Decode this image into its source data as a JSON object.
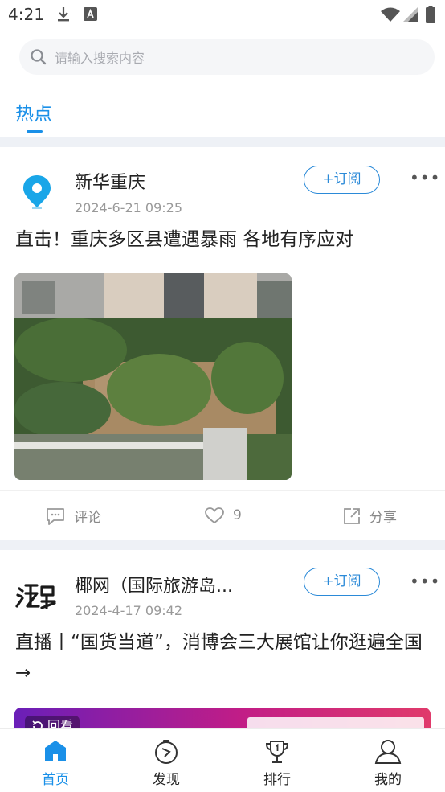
{
  "status_bar": {
    "time": "4:21"
  },
  "search": {
    "placeholder": "请输入搜索内容"
  },
  "tabs": [
    {
      "label": "热点",
      "active": true
    }
  ],
  "feed": [
    {
      "source": "新华重庆",
      "time": "2024-6-21 09:25",
      "subscribe_label": "+订阅",
      "headline": "直击！重庆多区县遭遇暴雨 各地有序应对",
      "actions": {
        "comment_label": "评论",
        "like_count": "9",
        "share_label": "分享"
      }
    },
    {
      "source": "椰网（国际旅游岛...",
      "time": "2024-4-17 09:42",
      "subscribe_label": "+订阅",
      "headline": "直播丨“国货当道”，消博会三大展馆让你逛遍全国→",
      "banner_text": "回看"
    }
  ],
  "bottom_nav": [
    {
      "label": "首页",
      "icon": "home-icon",
      "active": true
    },
    {
      "label": "发现",
      "icon": "compass-icon",
      "active": false
    },
    {
      "label": "排行",
      "icon": "trophy-icon",
      "active": false
    },
    {
      "label": "我的",
      "icon": "user-icon",
      "active": false
    }
  ],
  "colors": {
    "accent": "#1a90e8",
    "subscribe": "#2b8ad8",
    "divider": "#eef1f6"
  }
}
